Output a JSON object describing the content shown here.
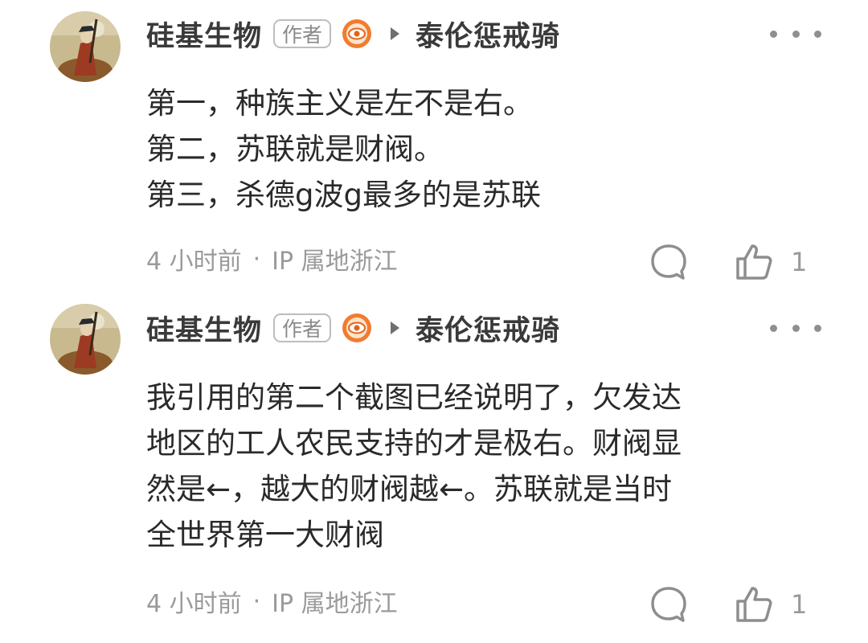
{
  "comments": [
    {
      "author": "硅基生物",
      "badge": "作者",
      "level_icon": "eye-level-icon",
      "reply_target": "泰伦惩戒骑",
      "lines": [
        "第一，种族主义是左不是右。",
        "第二，苏联就是财阀。",
        "第三，杀德g波g最多的是苏联"
      ],
      "time": "4 小时前",
      "separator": "·",
      "location": "IP 属地浙江",
      "likes": "1"
    },
    {
      "author": "硅基生物",
      "badge": "作者",
      "level_icon": "eye-level-icon",
      "reply_target": "泰伦惩戒骑",
      "lines": [
        "我引用的第二个截图已经说明了，欠发达",
        "地区的工人农民支持的才是极右。财阀显",
        "然是←，越大的财阀越←。苏联就是当时",
        "全世界第一大财阀"
      ],
      "time": "4 小时前",
      "separator": "·",
      "location": "IP 属地浙江",
      "likes": "1"
    }
  ],
  "colors": {
    "text_primary": "#2a2a2a",
    "text_secondary": "#9a9a9a",
    "badge_border": "#bdbdbd",
    "level_icon_orange": "#f07c2f"
  }
}
